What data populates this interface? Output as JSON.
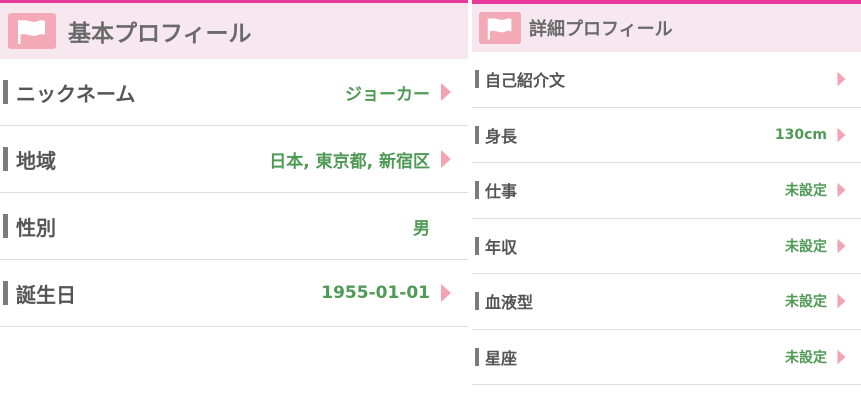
{
  "basic": {
    "title": "基本プロフィール",
    "rows": [
      {
        "label": "ニックネーム",
        "value": "ジョーカー",
        "has_chevron": true
      },
      {
        "label": "地域",
        "value": "日本, 東京都, 新宿区",
        "has_chevron": true
      },
      {
        "label": "性別",
        "value": "男",
        "has_chevron": false
      },
      {
        "label": "誕生日",
        "value": "1955-01-01",
        "has_chevron": true
      }
    ]
  },
  "detail": {
    "title": "詳細プロフィール",
    "rows": [
      {
        "label": "自己紹介文",
        "value": "",
        "has_chevron": true
      },
      {
        "label": "身長",
        "value": "130cm",
        "has_chevron": true
      },
      {
        "label": "仕事",
        "value": "未設定",
        "has_chevron": true
      },
      {
        "label": "年収",
        "value": "未設定",
        "has_chevron": true
      },
      {
        "label": "血液型",
        "value": "未設定",
        "has_chevron": true
      },
      {
        "label": "星座",
        "value": "未設定",
        "has_chevron": true
      }
    ]
  },
  "icons": {
    "section": "flag-icon",
    "row_action": "chevron-right-icon"
  },
  "colors": {
    "accent_bar": "#e83a9e",
    "header_bg": "#f6e8ee",
    "flag": "#f4a9b6",
    "value_text": "#4f9a55",
    "chevron": "#f4a3b4",
    "label_text": "#555555"
  }
}
